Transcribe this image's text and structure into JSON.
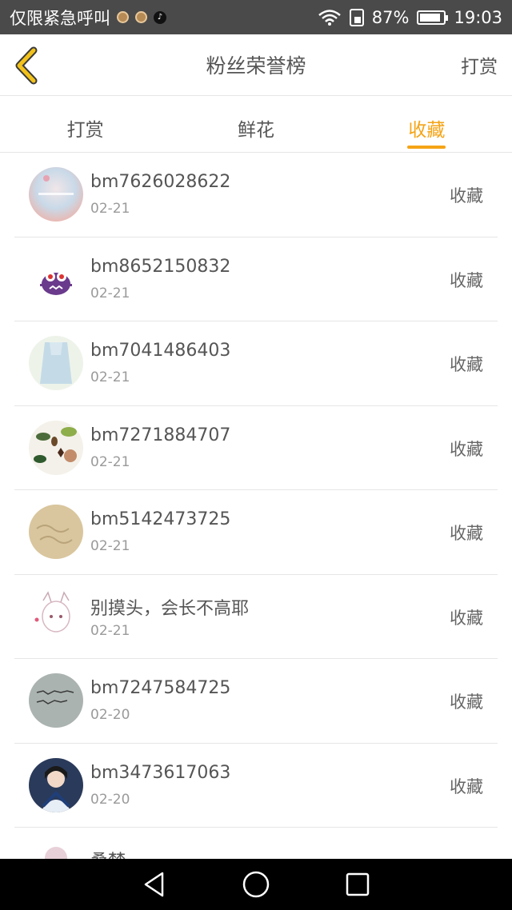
{
  "status_bar": {
    "carrier": "仅限紧急呼叫",
    "battery": "87%",
    "battery_level": 0.87,
    "time": "19:03"
  },
  "header": {
    "title": "粉丝荣誉榜",
    "action": "打赏"
  },
  "tabs": [
    {
      "label": "打赏",
      "active": false
    },
    {
      "label": "鲜花",
      "active": false
    },
    {
      "label": "收藏",
      "active": true
    }
  ],
  "items": [
    {
      "name": "bm7626028622",
      "date": "02-21",
      "action": "收藏",
      "avatar": "pastel-blur-avatar"
    },
    {
      "name": "bm8652150832",
      "date": "02-21",
      "action": "收藏",
      "avatar": "purple-monster-avatar"
    },
    {
      "name": "bm7041486403",
      "date": "02-21",
      "action": "收藏",
      "avatar": "blue-dress-avatar"
    },
    {
      "name": "bm7271884707",
      "date": "02-21",
      "action": "收藏",
      "avatar": "leaves-spices-avatar"
    },
    {
      "name": "bm5142473725",
      "date": "02-21",
      "action": "收藏",
      "avatar": "sand-writing-avatar"
    },
    {
      "name": "别摸头，会长不高耶",
      "date": "02-21",
      "action": "收藏",
      "avatar": "anime-cat-girl-avatar"
    },
    {
      "name": "bm7247584725",
      "date": "02-20",
      "action": "收藏",
      "avatar": "handwriting-avatar"
    },
    {
      "name": "bm3473617063",
      "date": "02-20",
      "action": "收藏",
      "avatar": "girl-portrait-avatar"
    },
    {
      "name": "桑梦",
      "date": "",
      "action": "",
      "avatar": "partial-avatar"
    }
  ],
  "colors": {
    "accent": "#f5a416",
    "status_bar": "#4a4a4a",
    "nav_bar": "#000000",
    "text": "#555555"
  }
}
